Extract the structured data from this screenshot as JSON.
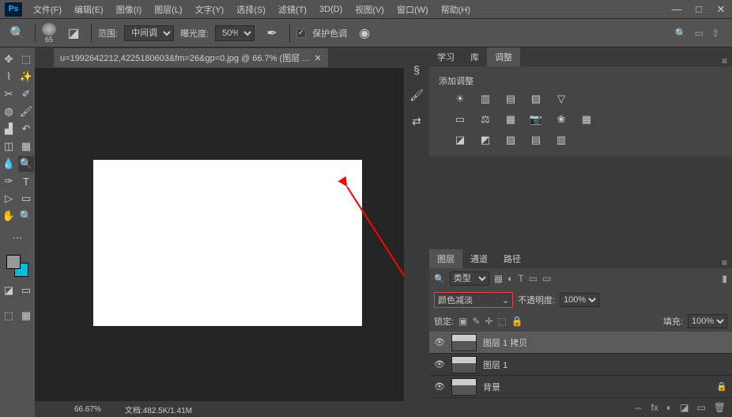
{
  "app": {
    "logo": "Ps"
  },
  "menu": [
    "文件(F)",
    "编辑(E)",
    "图像(I)",
    "图层(L)",
    "文字(Y)",
    "选择(S)",
    "滤镜(T)",
    "3D(D)",
    "视图(V)",
    "窗口(W)",
    "帮助(H)"
  ],
  "window_controls": {
    "min": "—",
    "max": "□",
    "close": "✕"
  },
  "options": {
    "range_label": "范围:",
    "range_value": "中间调",
    "exposure_label": "曝光度:",
    "exposure_value": "50%",
    "preserve_tone": "保护色调",
    "brush_size": "65"
  },
  "doc": {
    "tab_title": "u=1992642212,4225180603&fm=26&gp=0.jpg @ 66.7% (图层 ...",
    "zoom": "66.67%",
    "doc_size_label": "文档:",
    "doc_size": "482.5K/1.41M"
  },
  "vert_panel_icons": [
    "§",
    "🖌",
    "⇄"
  ],
  "adjustments": {
    "tabs": {
      "learn": "学习",
      "library": "库",
      "adjust": "调整"
    },
    "title": "添加调整",
    "row1": [
      "☀",
      "▥",
      "▤",
      "▨",
      "▽"
    ],
    "row2": [
      "▭",
      "⚖",
      "▦",
      "📷",
      "❀",
      "▦"
    ],
    "row3": [
      "◪",
      "◩",
      "▨",
      "▤",
      "▥"
    ]
  },
  "layers": {
    "tabs": {
      "layers": "图层",
      "channels": "通道",
      "paths": "路径"
    },
    "type_label": "类型",
    "blend_mode": "颜色减淡",
    "opacity_label": "不透明度:",
    "opacity": "100%",
    "lock_label": "锁定:",
    "fill_label": "填充:",
    "fill": "100%",
    "lock_icons": [
      "▣",
      "✎",
      "✛",
      "⬚",
      "🔒"
    ],
    "type_icons": [
      "▦",
      "◐",
      "T",
      "▭",
      "▭",
      "▮"
    ],
    "items": [
      {
        "name": "图层 1 拷贝",
        "selected": true,
        "locked": false
      },
      {
        "name": "图层 1",
        "selected": false,
        "locked": false
      },
      {
        "name": "背景",
        "selected": false,
        "locked": true
      }
    ],
    "bottom_icons": [
      "⇔",
      "fx",
      "◐",
      "◪",
      "▭",
      "🗑"
    ]
  }
}
